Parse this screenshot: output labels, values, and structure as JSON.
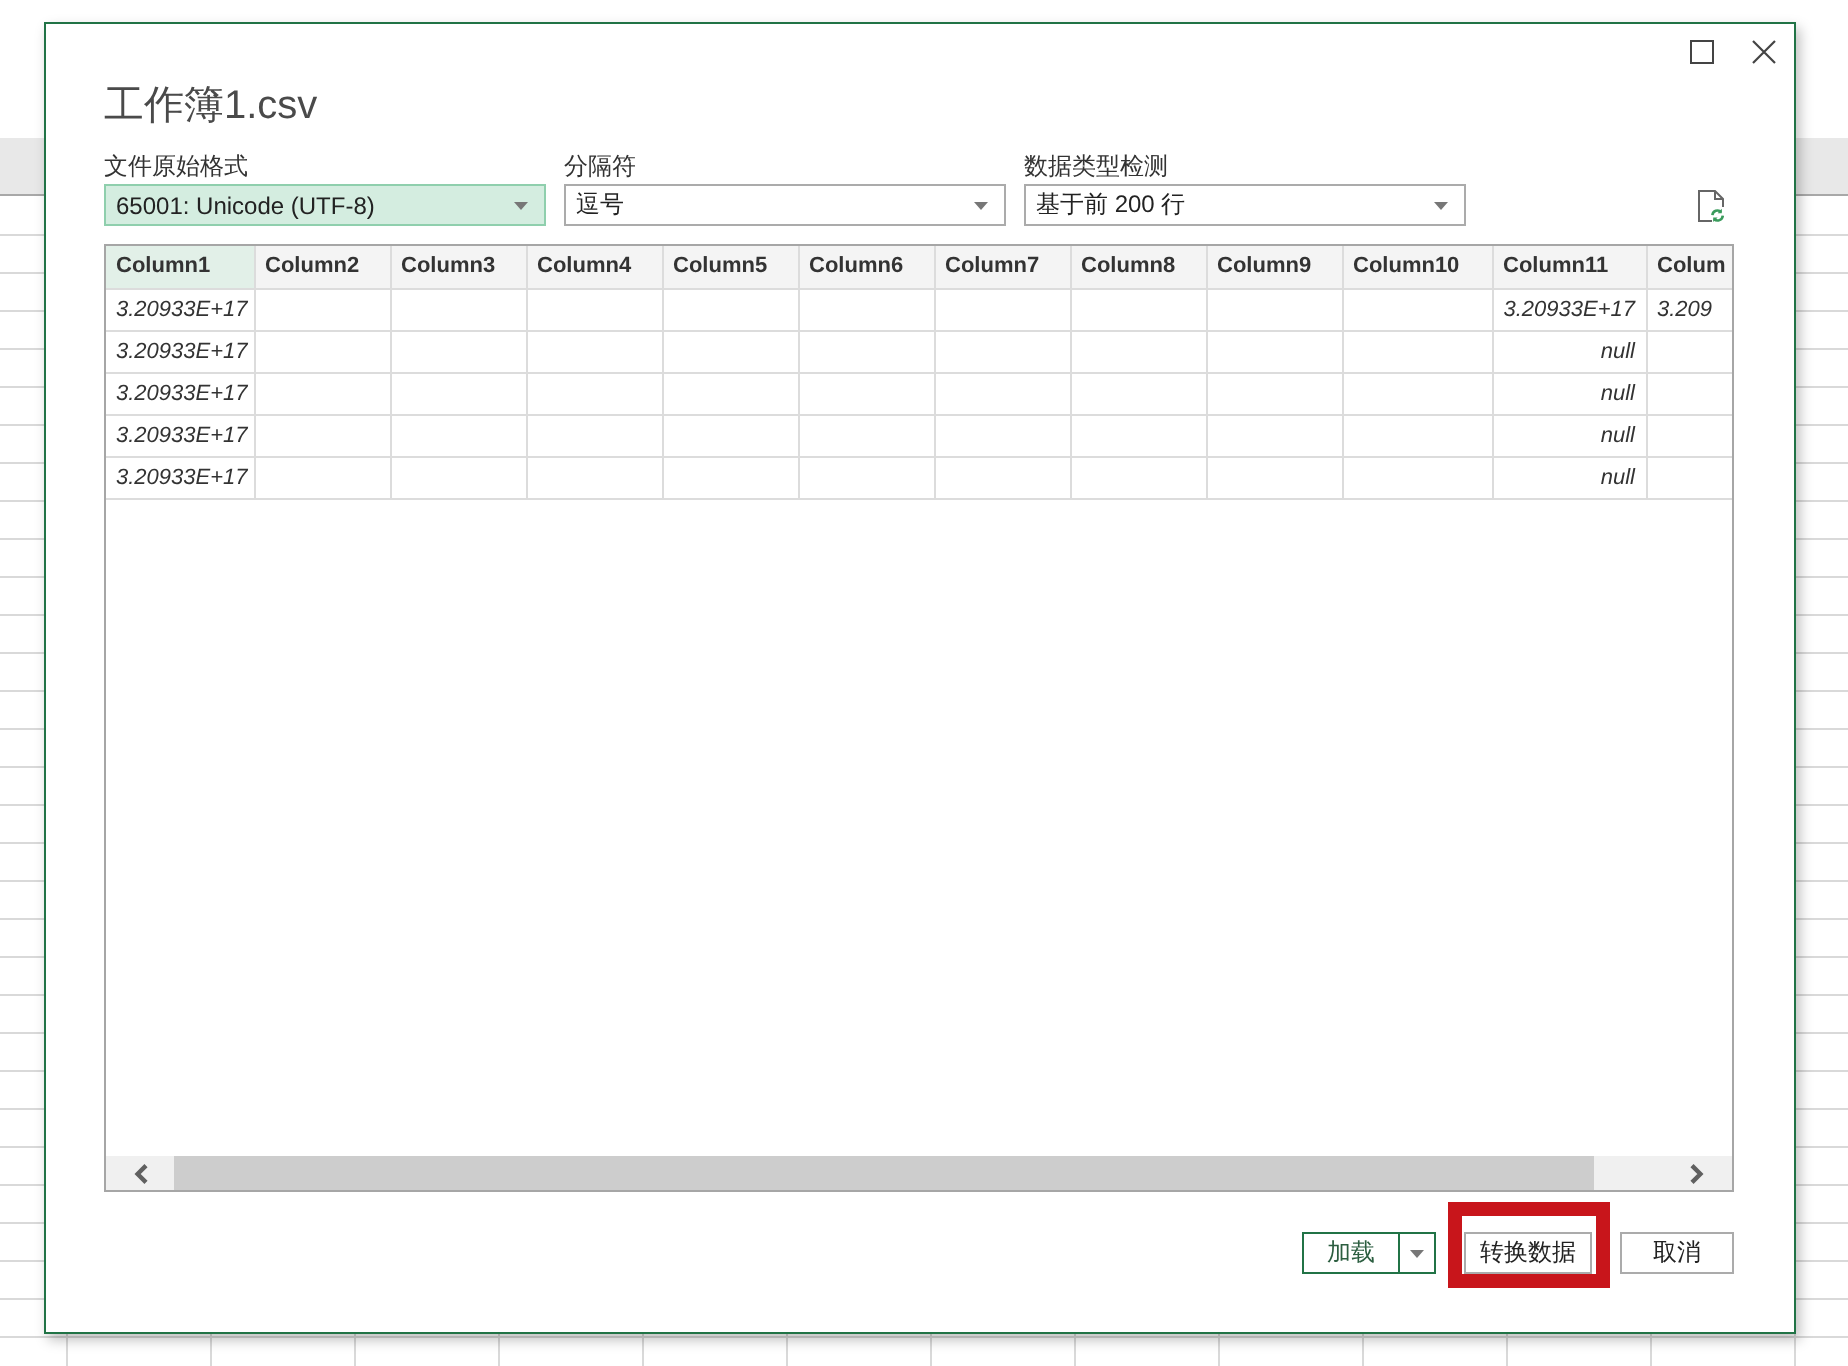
{
  "dialog": {
    "title": "工作簿1.csv"
  },
  "options": [
    {
      "label": "文件原始格式",
      "value": "65001: Unicode (UTF-8)",
      "focused": true
    },
    {
      "label": "分隔符",
      "value": "逗号",
      "focused": false
    },
    {
      "label": "数据类型检测",
      "value": "基于前 200 行",
      "focused": false
    }
  ],
  "preview": {
    "columns": [
      {
        "name": "Column1",
        "selected": true
      },
      {
        "name": "Column2",
        "selected": false
      },
      {
        "name": "Column3",
        "selected": false
      },
      {
        "name": "Column4",
        "selected": false
      },
      {
        "name": "Column5",
        "selected": false
      },
      {
        "name": "Column6",
        "selected": false
      },
      {
        "name": "Column7",
        "selected": false
      },
      {
        "name": "Column8",
        "selected": false
      },
      {
        "name": "Column9",
        "selected": false
      },
      {
        "name": "Column10",
        "selected": false
      },
      {
        "name": "Column11",
        "selected": false
      },
      {
        "name": "Colum",
        "selected": false
      }
    ],
    "rows": [
      [
        {
          "text": "3.20933E+17",
          "kind": "text"
        },
        null,
        null,
        null,
        null,
        null,
        null,
        null,
        null,
        null,
        {
          "text": "3.20933E+17",
          "kind": "number"
        },
        {
          "text": "3.209",
          "kind": "text"
        }
      ],
      [
        {
          "text": "3.20933E+17",
          "kind": "text"
        },
        null,
        null,
        null,
        null,
        null,
        null,
        null,
        null,
        null,
        {
          "text": "null",
          "kind": "number"
        },
        null
      ],
      [
        {
          "text": "3.20933E+17",
          "kind": "text"
        },
        null,
        null,
        null,
        null,
        null,
        null,
        null,
        null,
        null,
        {
          "text": "null",
          "kind": "number"
        },
        null
      ],
      [
        {
          "text": "3.20933E+17",
          "kind": "text"
        },
        null,
        null,
        null,
        null,
        null,
        null,
        null,
        null,
        null,
        {
          "text": "null",
          "kind": "number"
        },
        null
      ],
      [
        {
          "text": "3.20933E+17",
          "kind": "text"
        },
        null,
        null,
        null,
        null,
        null,
        null,
        null,
        null,
        null,
        {
          "text": "null",
          "kind": "number"
        },
        null
      ]
    ]
  },
  "buttons": [
    {
      "label": "加载",
      "kind": "split",
      "highlighted": false
    },
    {
      "label": "转换数据",
      "kind": "plain",
      "highlighted": true
    },
    {
      "label": "取消",
      "kind": "plain",
      "highlighted": false
    }
  ]
}
